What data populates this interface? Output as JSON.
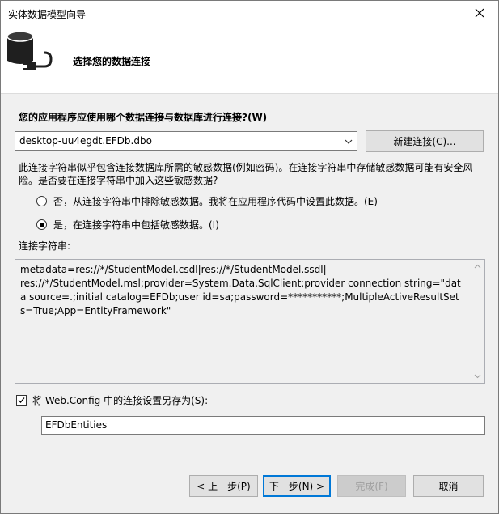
{
  "window": {
    "title": "实体数据模型向导"
  },
  "header": {
    "title": "选择您的数据连接",
    "icon": "database-plug-icon"
  },
  "question": "您的应用程序应使用哪个数据连接与数据库进行连接?(W)",
  "connection": {
    "selected": "desktop-uu4egdt.EFDb.dbo",
    "new_button": "新建连接(C)..."
  },
  "sensitive": {
    "warning": "此连接字符串似乎包含连接数据库所需的敏感数据(例如密码)。在连接字符串中存储敏感数据可能有安全风险。是否要在连接字符串中加入这些敏感数据?",
    "options": [
      {
        "label": "否，从连接字符串中排除敏感数据。我将在应用程序代码中设置此数据。(E)",
        "checked": false
      },
      {
        "label": "是，在连接字符串中包括敏感数据。(I)",
        "checked": true
      }
    ]
  },
  "connection_string": {
    "label": "连接字符串:",
    "value": "metadata=res://*/StudentModel.csdl|res://*/StudentModel.ssdl|\nres://*/StudentModel.msl;provider=System.Data.SqlClient;provider connection string=\"data source=.;initial catalog=EFDb;user id=sa;password=***********;MultipleActiveResultSets=True;App=EntityFramework\""
  },
  "save": {
    "checked": true,
    "label": "将 Web.Config 中的连接设置另存为(S):",
    "value": "EFDbEntities"
  },
  "buttons": {
    "back": "< 上一步(P)",
    "next": "下一步(N) >",
    "finish": "完成(F)",
    "cancel": "取消"
  },
  "colors": {
    "accent": "#0078d7",
    "header_bg": "#ffffff",
    "body_bg": "#f0f0f0"
  }
}
